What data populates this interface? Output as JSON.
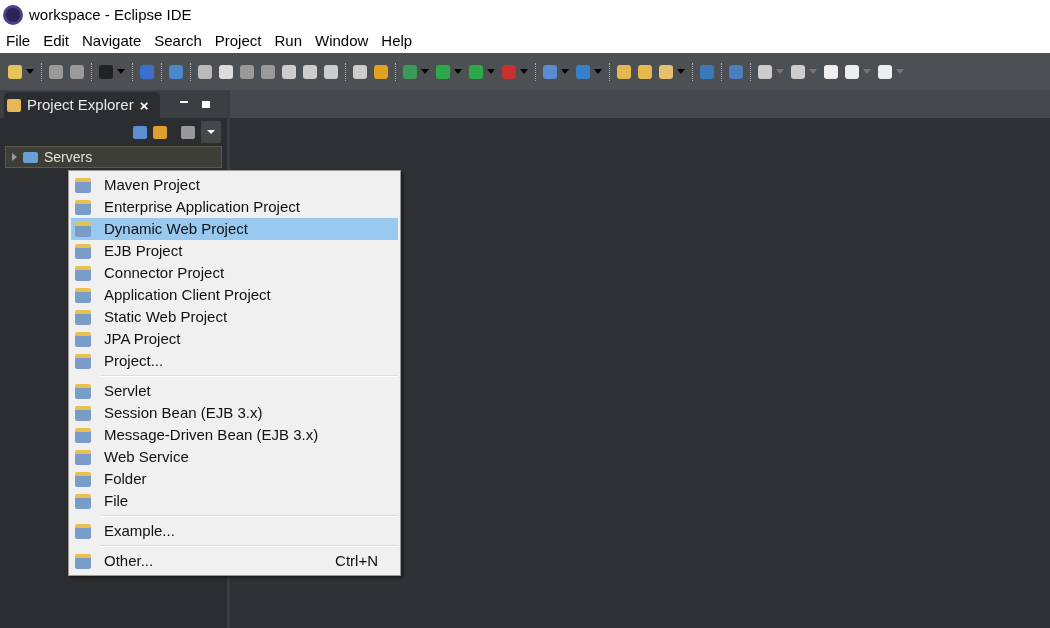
{
  "window": {
    "title": "workspace - Eclipse IDE"
  },
  "menu_bar": [
    "File",
    "Edit",
    "Navigate",
    "Search",
    "Project",
    "Run",
    "Window",
    "Help"
  ],
  "project_explorer": {
    "title": "Project Explorer",
    "close": "×",
    "tree": [
      {
        "label": "Servers",
        "expanded": false
      }
    ]
  },
  "context_menu": {
    "groups": [
      [
        {
          "label": "Maven Project",
          "selected": false
        },
        {
          "label": "Enterprise Application Project",
          "selected": false
        },
        {
          "label": "Dynamic Web Project",
          "selected": true
        },
        {
          "label": "EJB Project",
          "selected": false
        },
        {
          "label": "Connector Project",
          "selected": false
        },
        {
          "label": "Application Client Project",
          "selected": false
        },
        {
          "label": "Static Web Project",
          "selected": false
        },
        {
          "label": "JPA Project",
          "selected": false
        },
        {
          "label": "Project...",
          "selected": false
        }
      ],
      [
        {
          "label": "Servlet",
          "selected": false
        },
        {
          "label": "Session Bean (EJB 3.x)",
          "selected": false
        },
        {
          "label": "Message-Driven Bean (EJB 3.x)",
          "selected": false
        },
        {
          "label": "Web Service",
          "selected": false
        },
        {
          "label": "Folder",
          "selected": false
        },
        {
          "label": "File",
          "selected": false
        }
      ],
      [
        {
          "label": "Example...",
          "selected": false
        }
      ],
      [
        {
          "label": "Other...",
          "shortcut": "Ctrl+N",
          "selected": false
        }
      ]
    ]
  }
}
